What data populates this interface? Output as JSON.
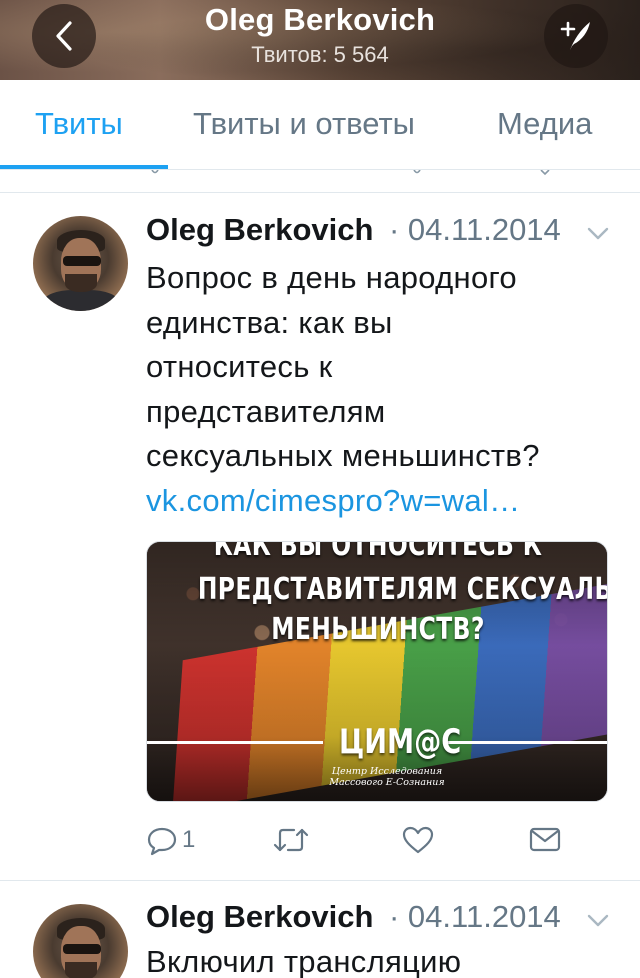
{
  "header": {
    "title": "Oleg Berkovich",
    "subtitle": "Твитов: 5 564",
    "back_icon": "chevron-left-icon",
    "compose_icon": "compose-tweet-icon"
  },
  "tabs": [
    {
      "label": "Твиты",
      "active": true
    },
    {
      "label": "Твиты и ответы",
      "active": false
    },
    {
      "label": "Медиа",
      "active": false
    }
  ],
  "colors": {
    "accent": "#1da1f2",
    "link": "#1b95e0",
    "secondary_text": "#657786",
    "primary_text": "#14171a"
  },
  "tweets": [
    {
      "author": "Oleg Berkovich",
      "meta": "· 04.11.2014",
      "text_lines": [
        "Вопрос в день народного",
        "единства: как вы",
        "относитесь к",
        "представителям",
        "сексуальных меньшинств?"
      ],
      "link": "vk.com/cimespro?w=wal…",
      "media": {
        "lines": [
          "КАК ВЫ ОТНОСИТЕСЬ К",
          "ПРЕДСТАВИТЕЛЯМ СЕКСУАЛЬНЫХ",
          "МЕНЬШИНСТВ?"
        ],
        "logo": "ЦИМ@С",
        "logo_subtitle": "Центр Исследования Массового Е-Сознания"
      },
      "actions": {
        "reply_count": "1",
        "reply_icon": "reply-icon",
        "retweet_icon": "retweet-icon",
        "like_icon": "heart-icon",
        "dm_icon": "envelope-icon"
      }
    },
    {
      "author": "Oleg Berkovich",
      "meta": "· 04.11.2014",
      "text_first_line": "Включил трансляцию"
    }
  ]
}
